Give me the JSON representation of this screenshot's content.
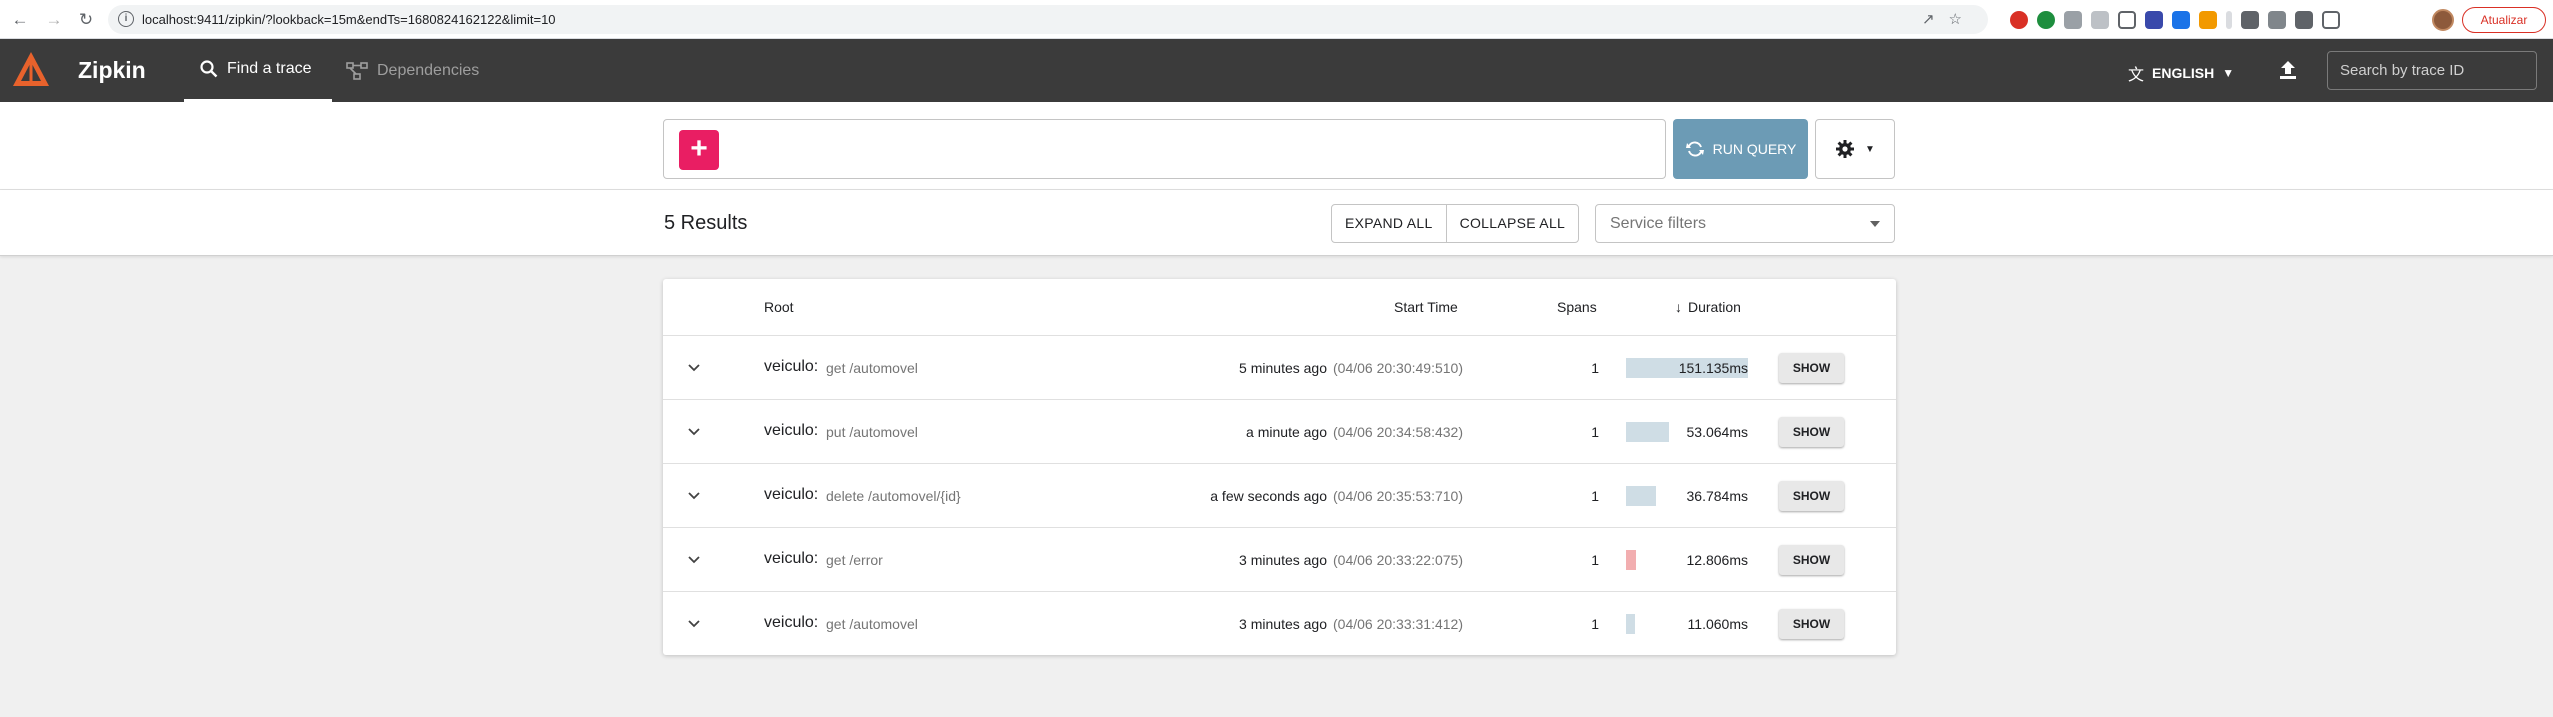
{
  "browser": {
    "url": "localhost:9411/zipkin/?lookback=15m&endTs=1680824162122&limit=10",
    "update_label": "Atualizar",
    "back_icon": "arrow-left-icon",
    "forward_icon": "arrow-right-icon",
    "reload_icon": "reload-icon"
  },
  "header": {
    "brand": "Zipkin",
    "tabs": [
      {
        "label": "Find a trace",
        "icon": "search-icon",
        "active": true
      },
      {
        "label": "Dependencies",
        "icon": "network-icon",
        "active": false
      }
    ],
    "language": "ENGLISH",
    "trace_search_placeholder": "Search by trace ID",
    "colors": {
      "header_bg": "#3b3b3b",
      "logo": "#e8622c"
    }
  },
  "query": {
    "add_label": "+",
    "run_label": "RUN QUERY",
    "colors": {
      "add": "#e91e63",
      "run": "#6c9bb5"
    }
  },
  "results": {
    "count_label": "5 Results",
    "expand_all": "EXPAND ALL",
    "collapse_all": "COLLAPSE ALL",
    "service_filter_placeholder": "Service filters"
  },
  "table": {
    "columns": {
      "root": "Root",
      "start": "Start Time",
      "spans": "Spans",
      "duration": "Duration"
    },
    "rows": [
      {
        "service": "veiculo:",
        "span": "get /automovel",
        "relative": "5 minutes ago",
        "absolute": "(04/06 20:30:49:510)",
        "spans": "1",
        "duration": "151.135ms",
        "duration_fraction": 1.0,
        "error": false,
        "show": "SHOW"
      },
      {
        "service": "veiculo:",
        "span": "put /automovel",
        "relative": "a minute ago",
        "absolute": "(04/06 20:34:58:432)",
        "spans": "1",
        "duration": "53.064ms",
        "duration_fraction": 0.351,
        "error": false,
        "show": "SHOW"
      },
      {
        "service": "veiculo:",
        "span": "delete /automovel/{id}",
        "relative": "a few seconds ago",
        "absolute": "(04/06 20:35:53:710)",
        "spans": "1",
        "duration": "36.784ms",
        "duration_fraction": 0.243,
        "error": false,
        "show": "SHOW"
      },
      {
        "service": "veiculo:",
        "span": "get /error",
        "relative": "3 minutes ago",
        "absolute": "(04/06 20:33:22:075)",
        "spans": "1",
        "duration": "12.806ms",
        "duration_fraction": 0.085,
        "error": true,
        "show": "SHOW"
      },
      {
        "service": "veiculo:",
        "span": "get /automovel",
        "relative": "3 minutes ago",
        "absolute": "(04/06 20:33:31:412)",
        "spans": "1",
        "duration": "11.060ms",
        "duration_fraction": 0.073,
        "error": false,
        "show": "SHOW"
      }
    ],
    "colors": {
      "ok_bar": "#cfdde5",
      "error_bar": "#f2aeb0"
    }
  }
}
